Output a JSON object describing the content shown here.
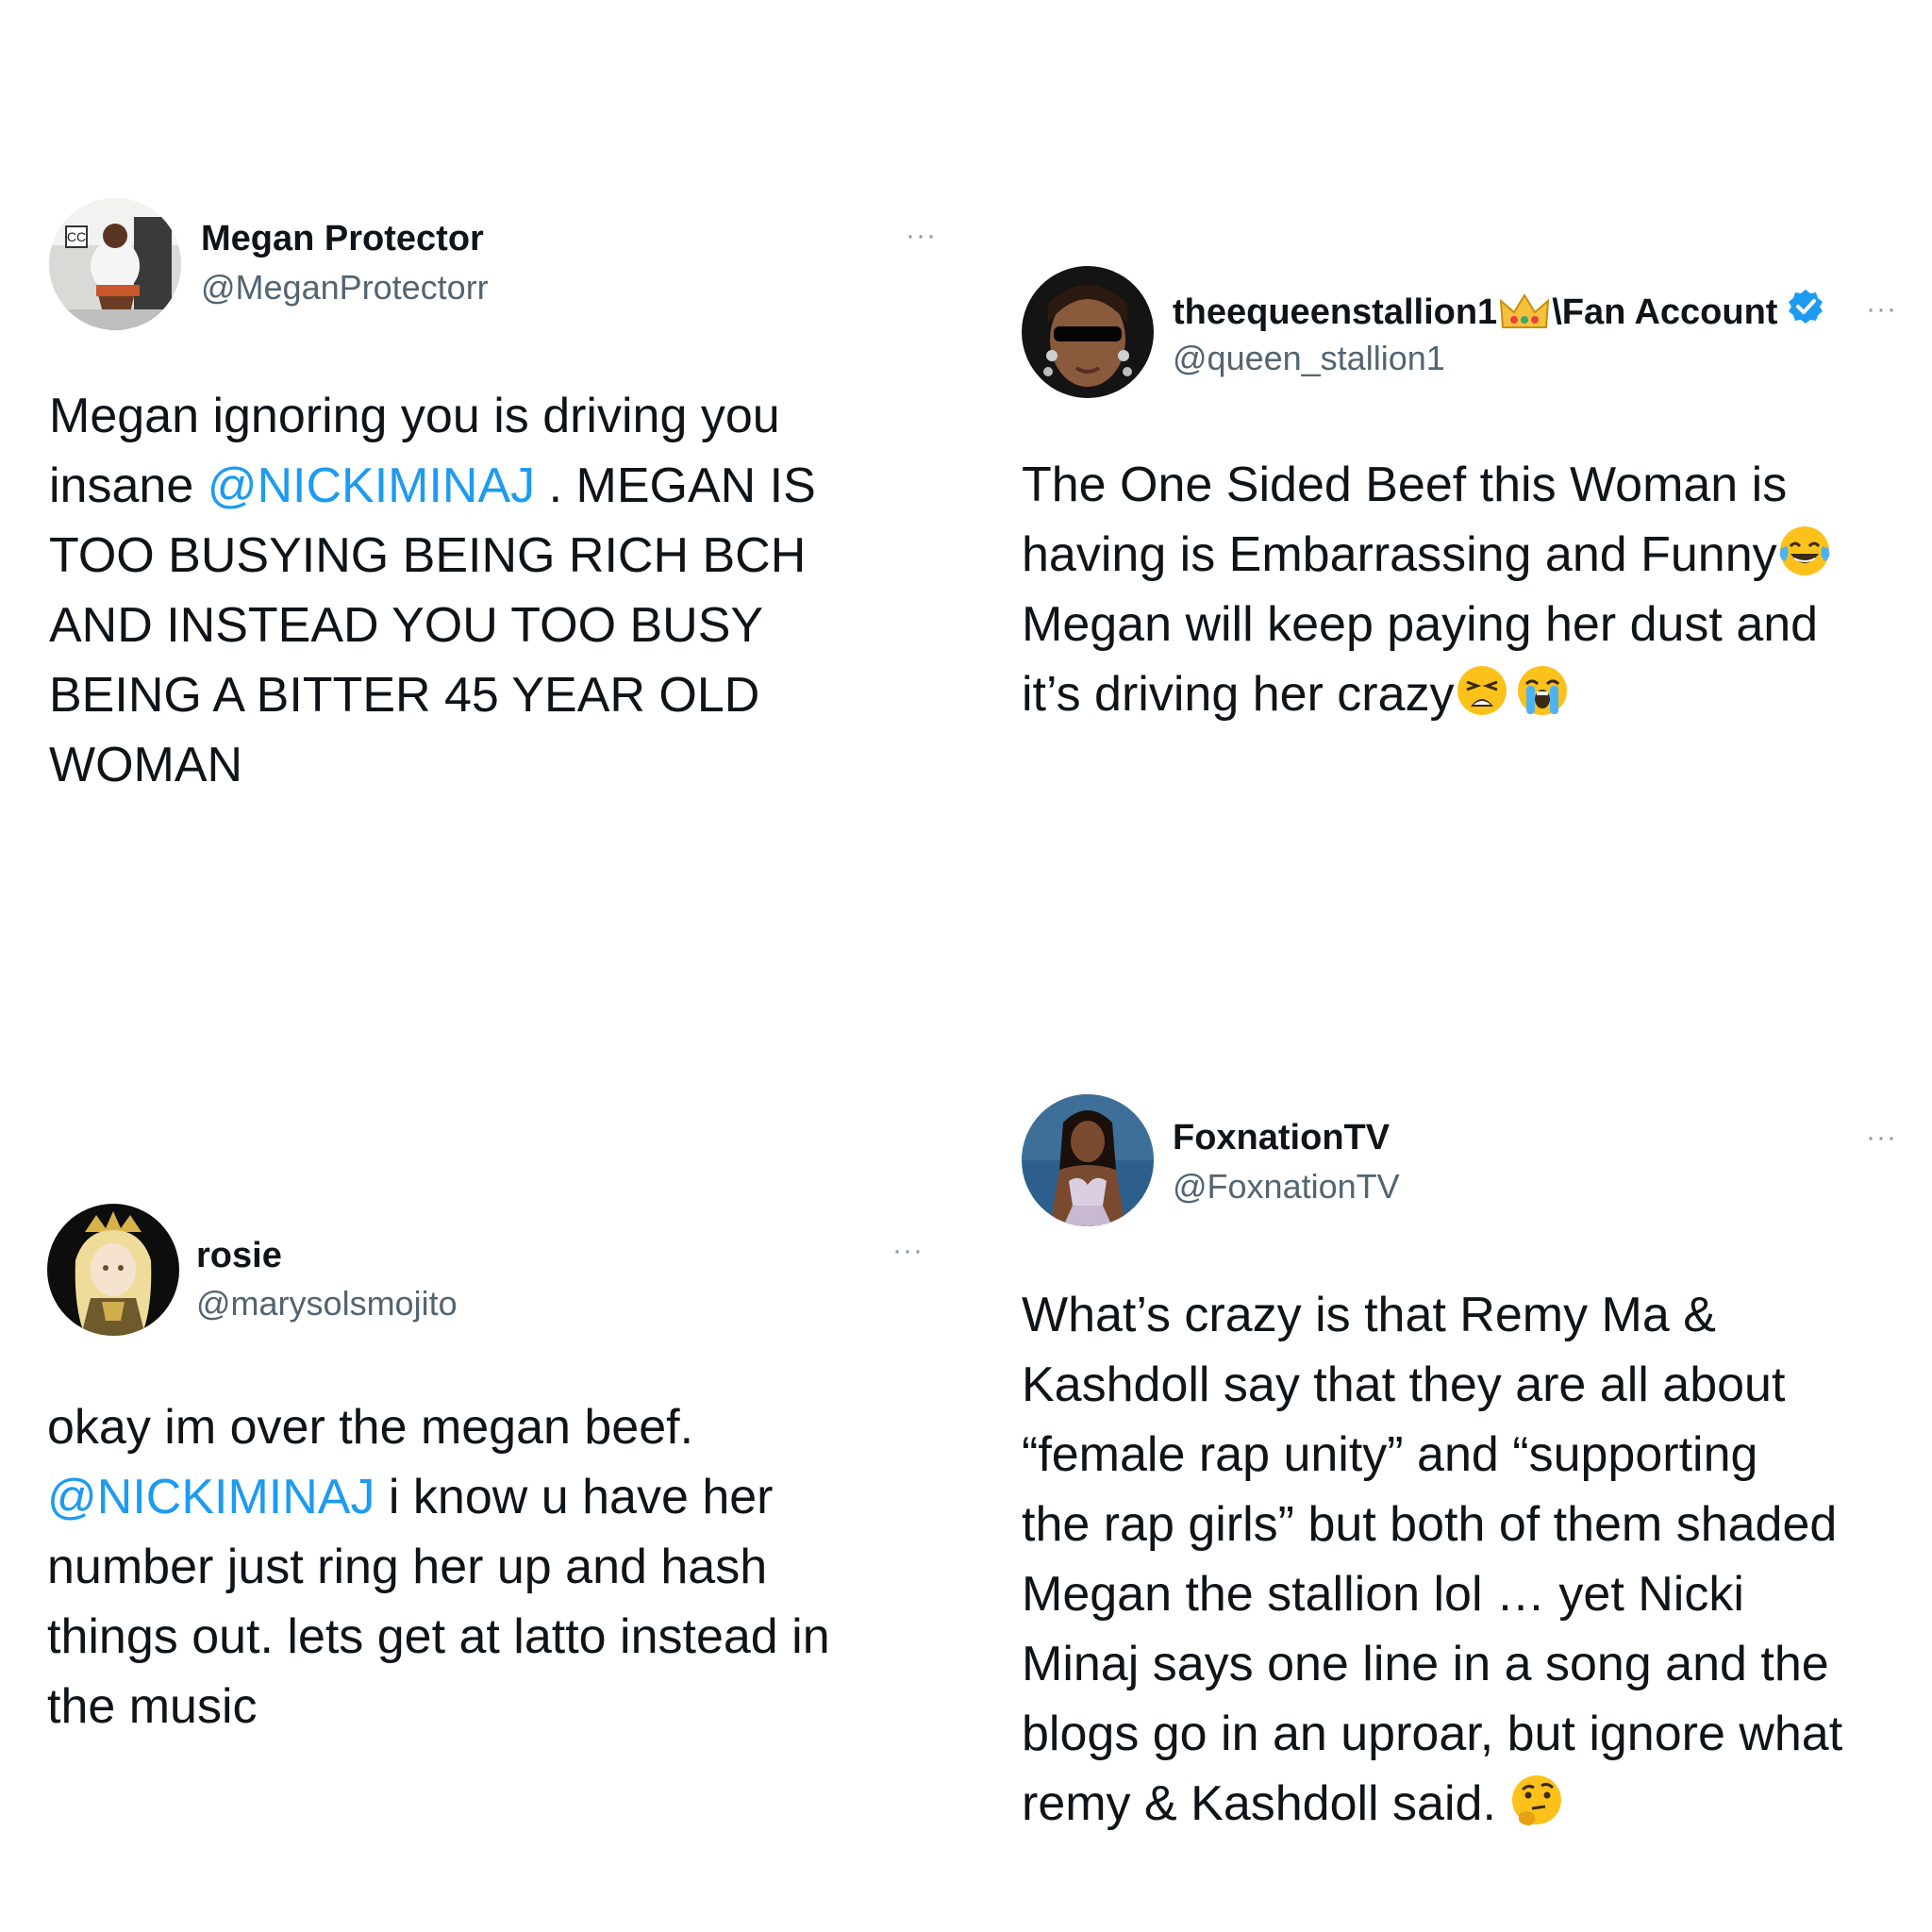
{
  "tweets": [
    {
      "name": "Megan Protector",
      "handle": "@MeganProtectorr",
      "text_lines": [
        "Megan ignoring you is driving you",
        "insane ",
        "TOO BUSYING BEING RICH BCH",
        "AND INSTEAD YOU TOO BUSY",
        "BEING A BITTER 45 YEAR OLD",
        "WOMAN"
      ],
      "mention": "@NICKIMINAJ",
      "after_mention": " . MEGAN IS",
      "more_label": "···"
    },
    {
      "name_main": "theequeenstallion1",
      "name_emoji": "crown-icon",
      "name_suffix": "\\Fan Account",
      "handle": "@queen_stallion1",
      "verified": true,
      "text_lines": [
        "The One Sided Beef this Woman is",
        "having is Embarrassing and Funny",
        "Megan will keep paying her dust and",
        "it’s driving her crazy"
      ],
      "more_label": "···",
      "emojis": [
        "tears-of-joy-emoji",
        "weary-face-emoji",
        "loudly-crying-emoji"
      ]
    },
    {
      "name": "rosie",
      "handle": "@marysolsmojito",
      "text_lines": [
        "okay im over the megan beef.",
        " i know u have her",
        "number just ring her up and hash",
        "things out. lets get at latto instead in",
        "the music"
      ],
      "mention": "@NICKIMINAJ",
      "more_label": "···"
    },
    {
      "name": "FoxnationTV",
      "handle": "@FoxnationTV",
      "text_lines": [
        "What’s crazy is that Remy Ma &",
        "Kashdoll say that they are all about",
        "“female rap unity” and “supporting",
        "the rap girls” but both of them shaded",
        "Megan the stallion lol … yet Nicki",
        "Minaj says one line in a song and the",
        "blogs go in an uproar, but ignore what",
        "remy & Kashdoll said. "
      ],
      "more_label": "···",
      "emojis": [
        "thinking-face-emoji"
      ]
    }
  ],
  "colors": {
    "text": "#0f1419",
    "secondary": "#536471",
    "link": "#1d9bf0",
    "background": "#ffffff"
  }
}
